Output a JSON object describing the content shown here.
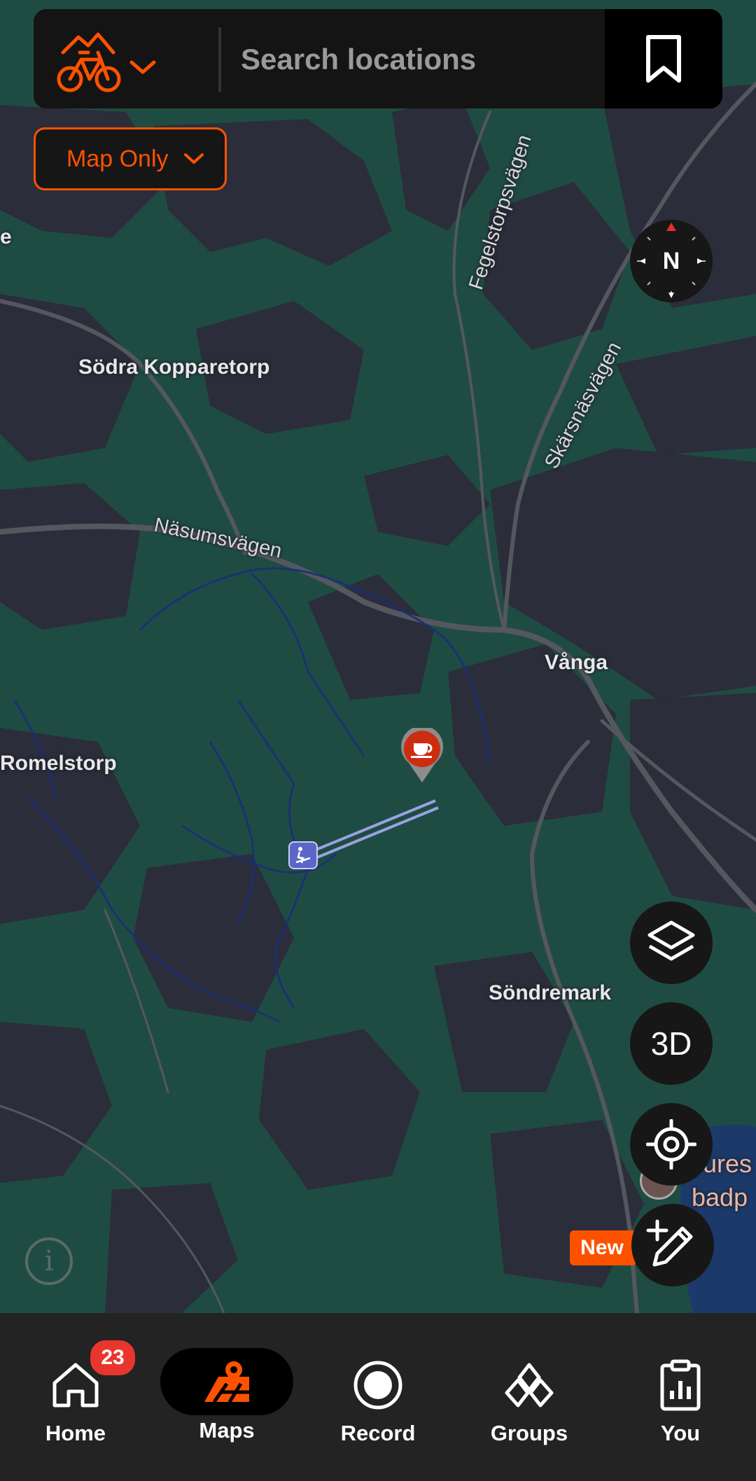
{
  "search": {
    "placeholder": "Search locations"
  },
  "filter": {
    "label": "Map Only"
  },
  "map": {
    "places": {
      "sodra_kopparetorp": "Södra Kopparetorp",
      "romelstorp": "Romelstorp",
      "vanga": "Vånga",
      "sondremark": "Söndremark",
      "edge_left": "e",
      "edge_right_1": "ures",
      "edge_right_2": "badp"
    },
    "roads": {
      "nasumsvagen": "Näsumsvägen",
      "fegelstorpsvagen": "Fegelstorpsvägen",
      "skarsnasvagen": "Skärsnäsvägen"
    }
  },
  "controls": {
    "compass_label": "N",
    "three_d_label": "3D",
    "new_badge": "New"
  },
  "nav": {
    "home": "Home",
    "home_badge": "23",
    "maps": "Maps",
    "record": "Record",
    "groups": "Groups",
    "you": "You"
  },
  "colors": {
    "accent": "#fc5200",
    "badge": "#e8362e",
    "map_green": "#1e4a40",
    "map_dark": "#2a2c38",
    "nav_bg": "#232323"
  }
}
